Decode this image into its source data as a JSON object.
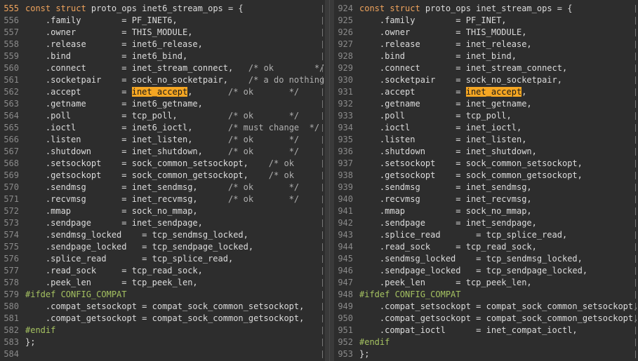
{
  "left": {
    "lines": [
      {
        "num": "555",
        "segments": [
          {
            "t": "const struct ",
            "c": "kw"
          },
          {
            "t": "proto_ops inet6_stream_ops = {",
            "c": "tx"
          }
        ],
        "current": true
      },
      {
        "num": "556",
        "segments": [
          {
            "t": "    .family        = PF_INET6,",
            "c": "tx"
          }
        ]
      },
      {
        "num": "557",
        "segments": [
          {
            "t": "    .owner         = THIS_MODULE,",
            "c": "tx"
          }
        ]
      },
      {
        "num": "558",
        "segments": [
          {
            "t": "    .release       = inet6_release,",
            "c": "tx"
          }
        ]
      },
      {
        "num": "559",
        "segments": [
          {
            "t": "    .bind          = inet6_bind,",
            "c": "tx"
          }
        ]
      },
      {
        "num": "560",
        "segments": [
          {
            "t": "    .connect       = inet_stream_connect,",
            "c": "tx"
          },
          {
            "t": "   /* ok        */",
            "c": "cm"
          }
        ]
      },
      {
        "num": "561",
        "segments": [
          {
            "t": "    .socketpair    = sock_no_socketpair,",
            "c": "tx"
          },
          {
            "t": "    /* a do nothing",
            "c": "cm"
          }
        ]
      },
      {
        "num": "562",
        "segments": [
          {
            "t": "    .accept        = ",
            "c": "tx"
          },
          {
            "t": "inet_accept",
            "c": "hl"
          },
          {
            "t": ",",
            "c": "tx"
          },
          {
            "t": "       /* ok       */",
            "c": "cm"
          }
        ]
      },
      {
        "num": "563",
        "segments": [
          {
            "t": "    .getname       = inet6_getname,",
            "c": "tx"
          }
        ]
      },
      {
        "num": "564",
        "segments": [
          {
            "t": "    .poll          = tcp_poll,",
            "c": "tx"
          },
          {
            "t": "          /* ok       */",
            "c": "cm"
          }
        ]
      },
      {
        "num": "565",
        "segments": [
          {
            "t": "    .ioctl         = inet6_ioctl,",
            "c": "tx"
          },
          {
            "t": "       /* must change  */",
            "c": "cm"
          }
        ]
      },
      {
        "num": "566",
        "segments": [
          {
            "t": "    .listen        = inet_listen,",
            "c": "tx"
          },
          {
            "t": "       /* ok       */",
            "c": "cm"
          }
        ]
      },
      {
        "num": "567",
        "segments": [
          {
            "t": "    .shutdown      = inet_shutdown,",
            "c": "tx"
          },
          {
            "t": "     /* ok       */",
            "c": "cm"
          }
        ]
      },
      {
        "num": "568",
        "segments": [
          {
            "t": "    .setsockopt    = sock_common_setsockopt,",
            "c": "tx"
          },
          {
            "t": "    /* ok",
            "c": "cm"
          }
        ]
      },
      {
        "num": "569",
        "segments": [
          {
            "t": "    .getsockopt    = sock_common_getsockopt,",
            "c": "tx"
          },
          {
            "t": "    /* ok",
            "c": "cm"
          }
        ]
      },
      {
        "num": "570",
        "segments": [
          {
            "t": "    .sendmsg       = inet_sendmsg,",
            "c": "tx"
          },
          {
            "t": "      /* ok       */",
            "c": "cm"
          }
        ]
      },
      {
        "num": "571",
        "segments": [
          {
            "t": "    .recvmsg       = inet_recvmsg,",
            "c": "tx"
          },
          {
            "t": "      /* ok       */",
            "c": "cm"
          }
        ]
      },
      {
        "num": "572",
        "segments": [
          {
            "t": "    .mmap          = sock_no_mmap,",
            "c": "tx"
          }
        ]
      },
      {
        "num": "573",
        "segments": [
          {
            "t": "    .sendpage      = inet_sendpage,",
            "c": "tx"
          }
        ]
      },
      {
        "num": "574",
        "segments": [
          {
            "t": "    .sendmsg_locked    = tcp_sendmsg_locked,",
            "c": "tx"
          }
        ]
      },
      {
        "num": "575",
        "segments": [
          {
            "t": "    .sendpage_locked   = tcp_sendpage_locked,",
            "c": "tx"
          }
        ]
      },
      {
        "num": "576",
        "segments": [
          {
            "t": "    .splice_read       = tcp_splice_read,",
            "c": "tx"
          }
        ]
      },
      {
        "num": "577",
        "segments": [
          {
            "t": "    .read_sock     = tcp_read_sock,",
            "c": "tx"
          }
        ]
      },
      {
        "num": "578",
        "segments": [
          {
            "t": "    .peek_len      = tcp_peek_len,",
            "c": "tx"
          }
        ]
      },
      {
        "num": "579",
        "segments": [
          {
            "t": "#ifdef CONFIG_COMPAT",
            "c": "pp"
          }
        ]
      },
      {
        "num": "580",
        "segments": [
          {
            "t": "    .compat_setsockopt = compat_sock_common_setsockopt,",
            "c": "tx"
          }
        ]
      },
      {
        "num": "581",
        "segments": [
          {
            "t": "    .compat_getsockopt = compat_sock_common_getsockopt,",
            "c": "tx"
          }
        ]
      },
      {
        "num": "582",
        "segments": [
          {
            "t": "#endif",
            "c": "pp"
          }
        ]
      },
      {
        "num": "583",
        "segments": [
          {
            "t": "};",
            "c": "tx"
          }
        ]
      },
      {
        "num": "584",
        "segments": []
      }
    ]
  },
  "right": {
    "lines": [
      {
        "num": "924",
        "segments": [
          {
            "t": "const struct ",
            "c": "kw"
          },
          {
            "t": "proto_ops inet_stream_ops = {",
            "c": "tx"
          }
        ]
      },
      {
        "num": "925",
        "segments": [
          {
            "t": "    .family        = PF_INET,",
            "c": "tx"
          }
        ]
      },
      {
        "num": "926",
        "segments": [
          {
            "t": "    .owner         = THIS_MODULE,",
            "c": "tx"
          }
        ]
      },
      {
        "num": "927",
        "segments": [
          {
            "t": "    .release       = inet_release,",
            "c": "tx"
          }
        ]
      },
      {
        "num": "928",
        "segments": [
          {
            "t": "    .bind          = inet_bind,",
            "c": "tx"
          }
        ]
      },
      {
        "num": "929",
        "segments": [
          {
            "t": "    .connect       = inet_stream_connect,",
            "c": "tx"
          }
        ]
      },
      {
        "num": "930",
        "segments": [
          {
            "t": "    .socketpair    = sock_no_socketpair,",
            "c": "tx"
          }
        ]
      },
      {
        "num": "931",
        "segments": [
          {
            "t": "    .accept        = ",
            "c": "tx"
          },
          {
            "t": "inet_accept",
            "c": "hl"
          },
          {
            "t": ",",
            "c": "tx"
          }
        ]
      },
      {
        "num": "932",
        "segments": [
          {
            "t": "    .getname       = inet_getname,",
            "c": "tx"
          }
        ]
      },
      {
        "num": "933",
        "segments": [
          {
            "t": "    .poll          = tcp_poll,",
            "c": "tx"
          }
        ]
      },
      {
        "num": "934",
        "segments": [
          {
            "t": "    .ioctl         = inet_ioctl,",
            "c": "tx"
          }
        ]
      },
      {
        "num": "935",
        "segments": [
          {
            "t": "    .listen        = inet_listen,",
            "c": "tx"
          }
        ]
      },
      {
        "num": "936",
        "segments": [
          {
            "t": "    .shutdown      = inet_shutdown,",
            "c": "tx"
          }
        ]
      },
      {
        "num": "937",
        "segments": [
          {
            "t": "    .setsockopt    = sock_common_setsockopt,",
            "c": "tx"
          }
        ]
      },
      {
        "num": "938",
        "segments": [
          {
            "t": "    .getsockopt    = sock_common_getsockopt,",
            "c": "tx"
          }
        ]
      },
      {
        "num": "939",
        "segments": [
          {
            "t": "    .sendmsg       = inet_sendmsg,",
            "c": "tx"
          }
        ]
      },
      {
        "num": "940",
        "segments": [
          {
            "t": "    .recvmsg       = inet_recvmsg,",
            "c": "tx"
          }
        ]
      },
      {
        "num": "941",
        "segments": [
          {
            "t": "    .mmap          = sock_no_mmap,",
            "c": "tx"
          }
        ]
      },
      {
        "num": "942",
        "segments": [
          {
            "t": "    .sendpage      = inet_sendpage,",
            "c": "tx"
          }
        ]
      },
      {
        "num": "943",
        "segments": [
          {
            "t": "    .splice_read       = tcp_splice_read,",
            "c": "tx"
          }
        ]
      },
      {
        "num": "944",
        "segments": [
          {
            "t": "    .read_sock     = tcp_read_sock,",
            "c": "tx"
          }
        ]
      },
      {
        "num": "945",
        "segments": [
          {
            "t": "    .sendmsg_locked    = tcp_sendmsg_locked,",
            "c": "tx"
          }
        ]
      },
      {
        "num": "946",
        "segments": [
          {
            "t": "    .sendpage_locked   = tcp_sendpage_locked,",
            "c": "tx"
          }
        ]
      },
      {
        "num": "947",
        "segments": [
          {
            "t": "    .peek_len      = tcp_peek_len,",
            "c": "tx"
          }
        ]
      },
      {
        "num": "948",
        "segments": [
          {
            "t": "#ifdef CONFIG_COMPAT",
            "c": "pp"
          }
        ]
      },
      {
        "num": "949",
        "segments": [
          {
            "t": "    .compat_setsockopt = compat_sock_common_setsockopt,",
            "c": "tx"
          }
        ]
      },
      {
        "num": "950",
        "segments": [
          {
            "t": "    .compat_getsockopt = compat_sock_common_getsockopt,",
            "c": "tx"
          }
        ]
      },
      {
        "num": "951",
        "segments": [
          {
            "t": "    .compat_ioctl      = inet_compat_ioctl,",
            "c": "tx"
          }
        ]
      },
      {
        "num": "952",
        "segments": [
          {
            "t": "#endif",
            "c": "pp"
          }
        ]
      },
      {
        "num": "953",
        "segments": [
          {
            "t": "};",
            "c": "tx"
          }
        ]
      }
    ]
  },
  "colors": {
    "background": "#2d2d2d",
    "keyword": "#f0a45d",
    "preprocessor": "#a5c261",
    "highlight": "#f5a623",
    "line_number": "#8a8a8a"
  }
}
